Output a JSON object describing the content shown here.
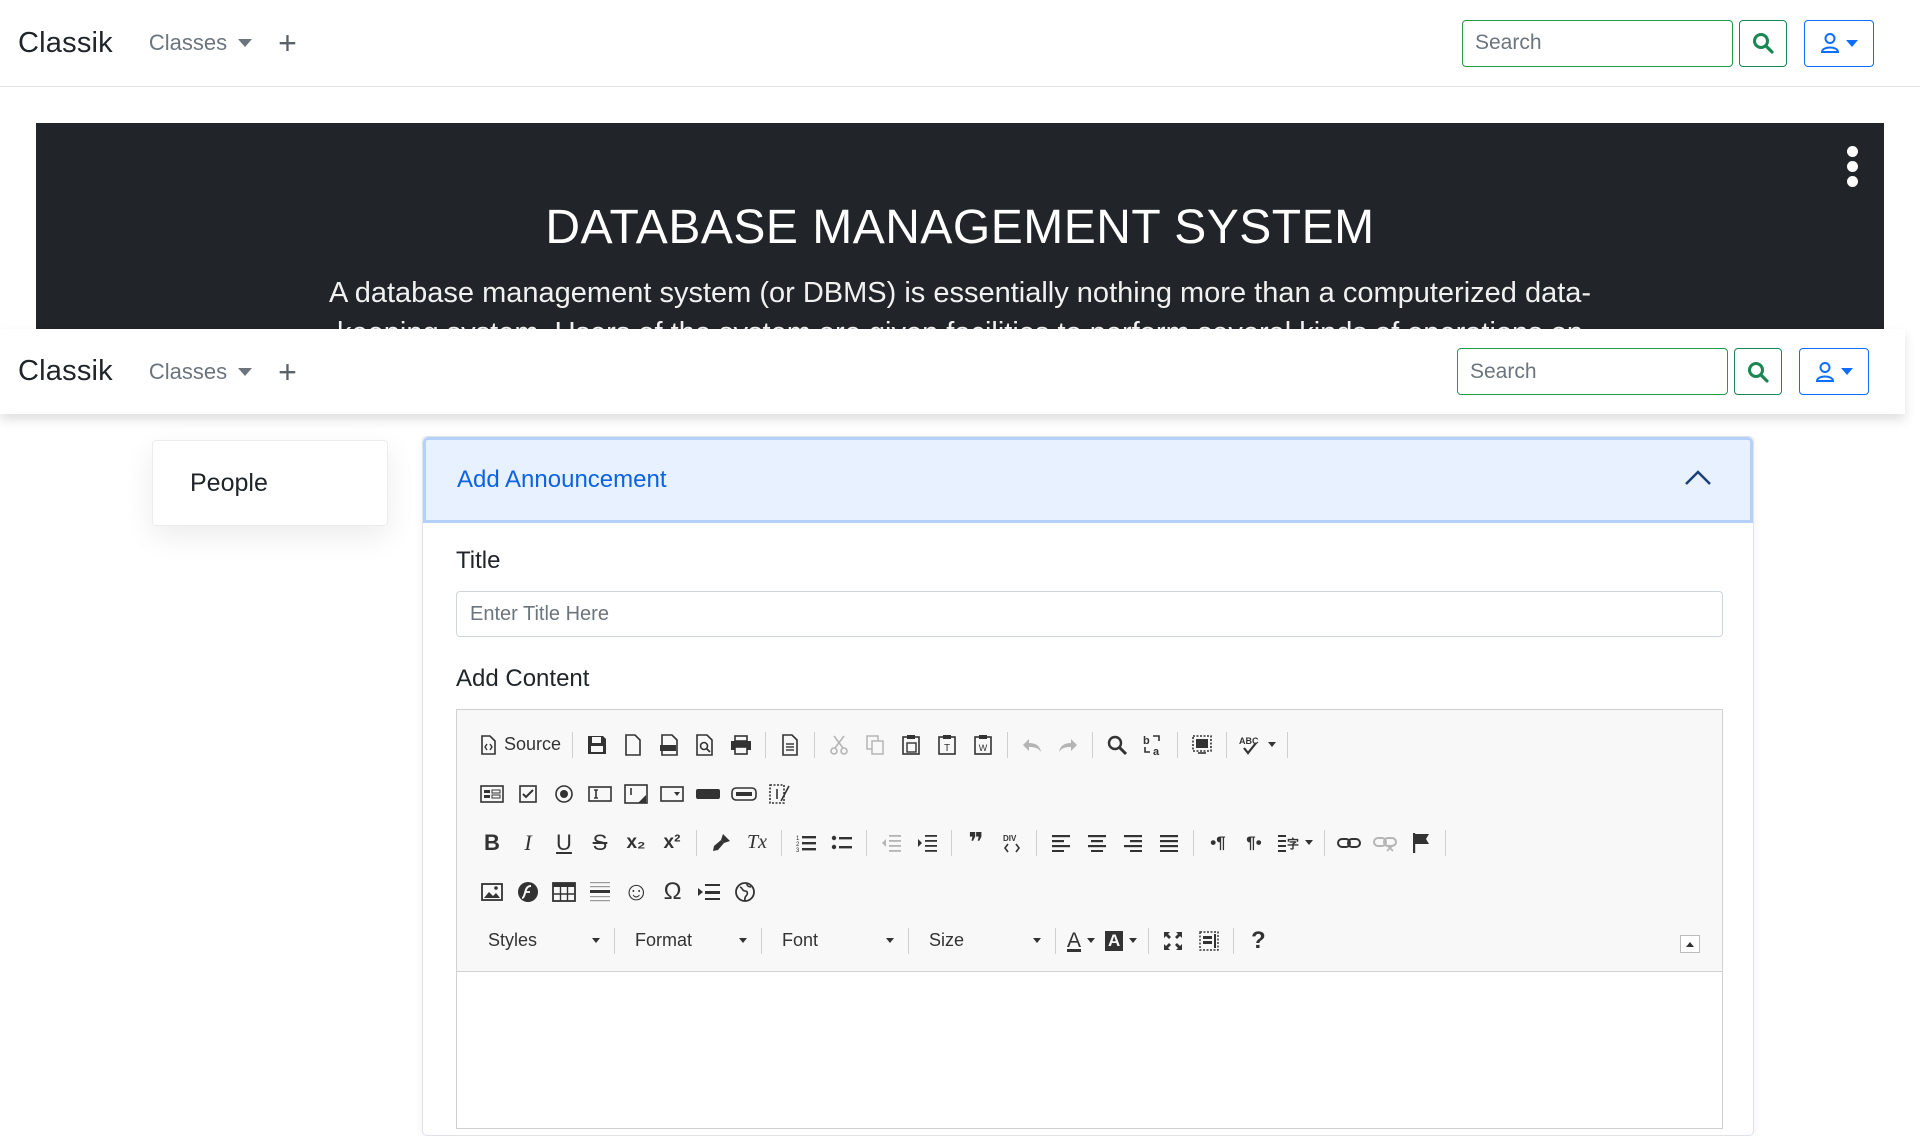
{
  "navbar": {
    "brand": "Classik",
    "classes_label": "Classes",
    "add_symbol": "+",
    "search_placeholder": "Search"
  },
  "banner": {
    "title": "DATABASE MANAGEMENT SYSTEM",
    "description": "A database management system (or DBMS) is essentially nothing more than a computerized data-keeping system. Users of the system are given facilities to perform several kinds of operations on"
  },
  "sidebar": {
    "items": [
      {
        "label": "People"
      }
    ]
  },
  "announcement": {
    "header": "Add Announcement",
    "title_label": "Title",
    "title_placeholder": "Enter Title Here",
    "content_label": "Add Content"
  },
  "editor": {
    "source_label": "Source",
    "combos": {
      "styles": "Styles",
      "format": "Format",
      "font": "Font",
      "size": "Size"
    },
    "glyphs": {
      "bold": "B",
      "italic": "I",
      "underline": "U",
      "strike": "S",
      "subscript": "x₂",
      "superscript": "x²",
      "clear_format": "Tx",
      "blockquote": "❞",
      "omega": "Ω",
      "smiley": "☺",
      "help": "?",
      "text_color": "A",
      "bg_color": "A",
      "ltr": "•¶",
      "rtl": "¶•"
    }
  },
  "colors": {
    "primary": "#0d6efd",
    "success": "#198754",
    "banner_bg": "#212529",
    "accordion_bg": "#e7f1ff"
  }
}
